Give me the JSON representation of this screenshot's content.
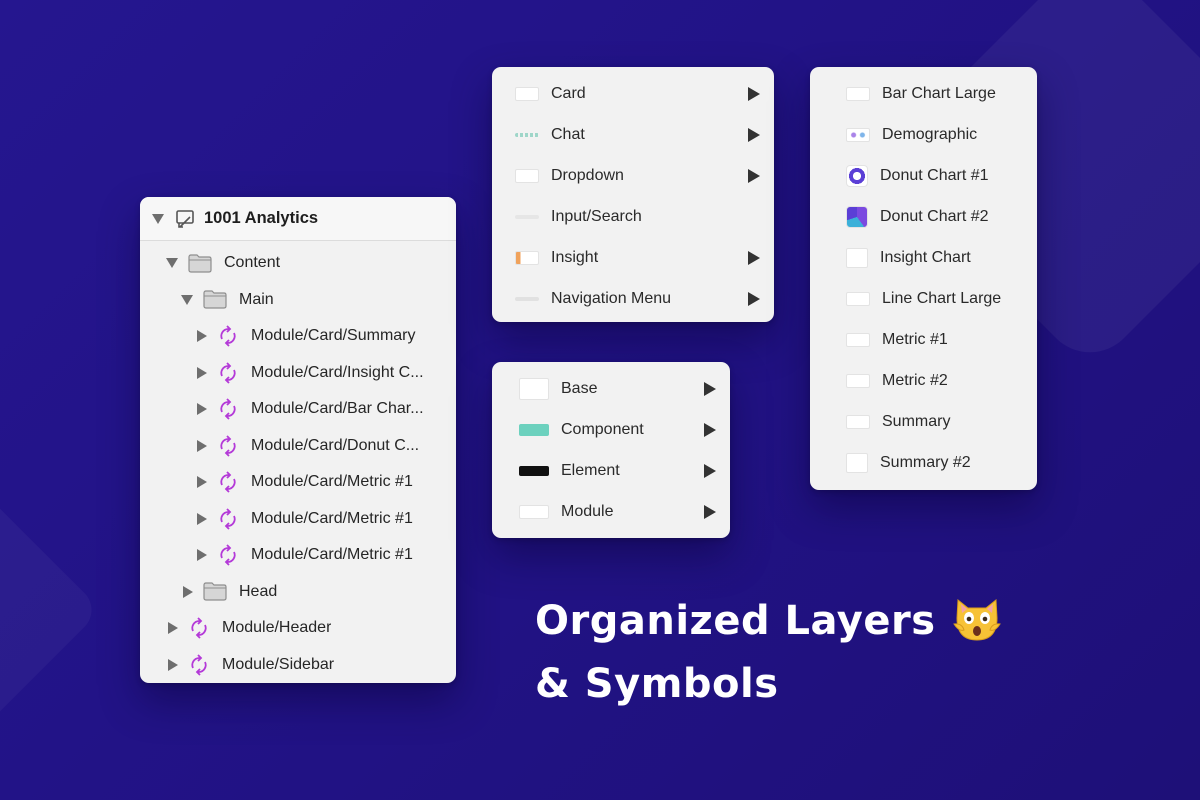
{
  "layers": {
    "title": "1001 Analytics",
    "rows": [
      {
        "label": "Content",
        "type": "folder",
        "expanded": true
      },
      {
        "label": "Main",
        "type": "folder",
        "expanded": true
      },
      {
        "label": "Module/Card/Summary",
        "type": "symbol"
      },
      {
        "label": "Module/Card/Insight C...",
        "type": "symbol"
      },
      {
        "label": "Module/Card/Bar Char...",
        "type": "symbol"
      },
      {
        "label": "Module/Card/Donut C...",
        "type": "symbol"
      },
      {
        "label": "Module/Card/Metric #1",
        "type": "symbol"
      },
      {
        "label": "Module/Card/Metric #1",
        "type": "symbol"
      },
      {
        "label": "Module/Card/Metric #1",
        "type": "symbol"
      },
      {
        "label": "Head",
        "type": "folder",
        "expanded": false
      },
      {
        "label": "Module/Header",
        "type": "symbol"
      },
      {
        "label": "Module/Sidebar",
        "type": "symbol"
      }
    ]
  },
  "module_menu": {
    "items": [
      {
        "label": "Card"
      },
      {
        "label": "Chat"
      },
      {
        "label": "Dropdown"
      },
      {
        "label": "Input/Search"
      },
      {
        "label": "Insight"
      },
      {
        "label": "Navigation Menu"
      }
    ]
  },
  "category_menu": {
    "items": [
      {
        "label": "Base"
      },
      {
        "label": "Component"
      },
      {
        "label": "Element"
      },
      {
        "label": "Module"
      }
    ]
  },
  "card_menu": {
    "items": [
      {
        "label": "Bar Chart Large"
      },
      {
        "label": "Demographic"
      },
      {
        "label": "Donut Chart #1"
      },
      {
        "label": "Donut Chart #2"
      },
      {
        "label": "Insight Chart"
      },
      {
        "label": "Line Chart Large"
      },
      {
        "label": "Metric #1"
      },
      {
        "label": "Metric #2"
      },
      {
        "label": "Summary"
      },
      {
        "label": "Summary #2"
      }
    ]
  },
  "headline": {
    "line1": "Organized Layers",
    "line2": "& Symbols",
    "emoji": "cat-scream-emoji"
  },
  "colors": {
    "background": "#22138a",
    "symbol_icon": "#b43ad8",
    "panel": "#f2f2f2",
    "folder_icon": "#8e8e8e"
  }
}
